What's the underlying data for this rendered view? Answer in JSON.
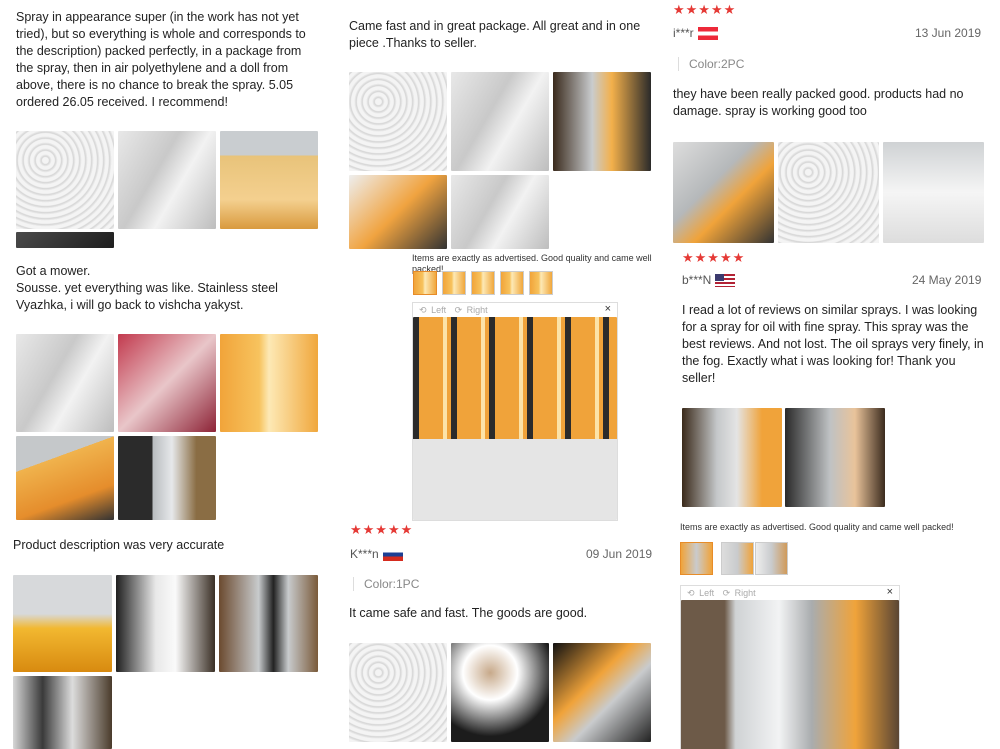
{
  "col1": {
    "review1_text": "Spray in appearance super (in the work has not yet tried), but so everything is whole and corresponds to the description) packed perfectly, in a package from the spray, then in air polyethylene and a doll from above, there is no chance to break the spray. 5.05 ordered 26.05 received. I recommend!",
    "review2_text": "Got a mower.\nSousse. yet everything was like. Stainless steel Vyazhka, i will go back to vishcha yakyst.",
    "review3_text": "Product description was very accurate"
  },
  "col2": {
    "review1_text": "Came fast and in great package.  All great and in one piece .Thanks to seller.",
    "caption": "Items are exactly as advertised. Good quality and came well packed!",
    "viewer_left": "Left",
    "viewer_right": "Right",
    "viewer_close": "×",
    "review2_stars": "★★★★★",
    "review2_user": "K***n",
    "review2_date": "09 Jun 2019",
    "review2_color": "Color:1PC",
    "review2_text": "It came safe and fast. The goods are good."
  },
  "col3": {
    "review1_stars": "★★★★★",
    "review1_user": "i***r",
    "review1_date": "13 Jun 2019",
    "review1_color": "Color:2PC",
    "review1_text": "they have been really packed good. products had no damage. spray is working good too",
    "review2_stars": "★★★★★",
    "review2_user": "b***N",
    "review2_date": "24 May 2019",
    "review2_text": "I read a lot of reviews on similar sprays. I was looking for a spray for oil with fine spray. This spray was the best reviews. And not lost. The oil sprays very finely, in the fog. Exactly what i was looking for! Thank you seller!",
    "caption": "Items are exactly as advertised. Good quality and came well packed!",
    "viewer_left": "Left",
    "viewer_right": "Right",
    "viewer_close": "×"
  },
  "icons": [
    "rotate-left-icon",
    "rotate-right-icon",
    "close-icon",
    "star-icon",
    "flag-icon"
  ],
  "colors": {
    "star": "#e53935",
    "accent": "#e78c28"
  }
}
